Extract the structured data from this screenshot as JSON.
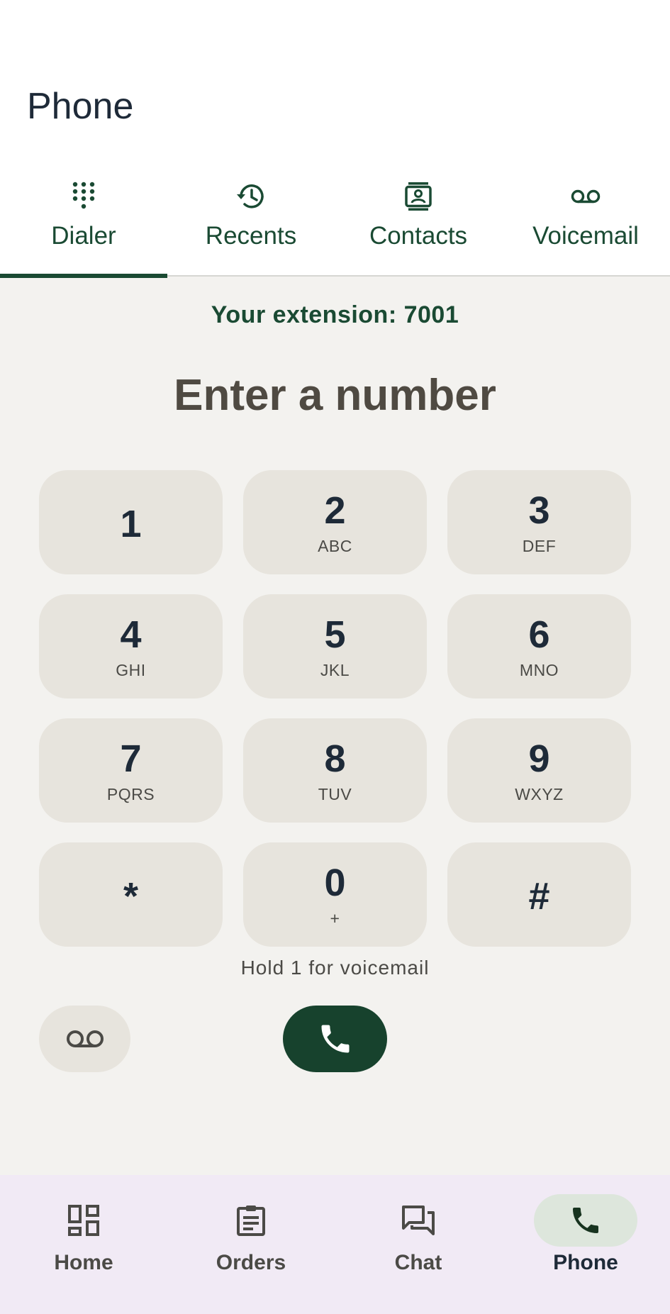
{
  "app": {
    "title": "Phone"
  },
  "tabs": [
    {
      "label": "Dialer",
      "icon": "dialpad-icon",
      "active": true
    },
    {
      "label": "Recents",
      "icon": "history-icon",
      "active": false
    },
    {
      "label": "Contacts",
      "icon": "contacts-icon",
      "active": false
    },
    {
      "label": "Voicemail",
      "icon": "voicemail-icon",
      "active": false
    }
  ],
  "dialer": {
    "extension_text": "Your extension: 7001",
    "number_placeholder": "Enter a number",
    "keys": [
      {
        "digit": "1",
        "letters": ""
      },
      {
        "digit": "2",
        "letters": "ABC"
      },
      {
        "digit": "3",
        "letters": "DEF"
      },
      {
        "digit": "4",
        "letters": "GHI"
      },
      {
        "digit": "5",
        "letters": "JKL"
      },
      {
        "digit": "6",
        "letters": "MNO"
      },
      {
        "digit": "7",
        "letters": "PQRS"
      },
      {
        "digit": "8",
        "letters": "TUV"
      },
      {
        "digit": "9",
        "letters": "WXYZ"
      },
      {
        "digit": "*",
        "letters": ""
      },
      {
        "digit": "0",
        "letters": "+"
      },
      {
        "digit": "#",
        "letters": ""
      }
    ],
    "hint": "Hold 1 for voicemail"
  },
  "bottom_nav": [
    {
      "label": "Home",
      "icon": "dashboard-icon",
      "active": false
    },
    {
      "label": "Orders",
      "icon": "clipboard-icon",
      "active": false
    },
    {
      "label": "Chat",
      "icon": "chat-icon",
      "active": false
    },
    {
      "label": "Phone",
      "icon": "phone-icon",
      "active": true
    }
  ],
  "colors": {
    "accent": "#1a4a33",
    "call_button": "#17422d",
    "key_bg": "#e7e4dd",
    "background": "#f3f2ef",
    "nav_bg": "#f1eaf5"
  }
}
